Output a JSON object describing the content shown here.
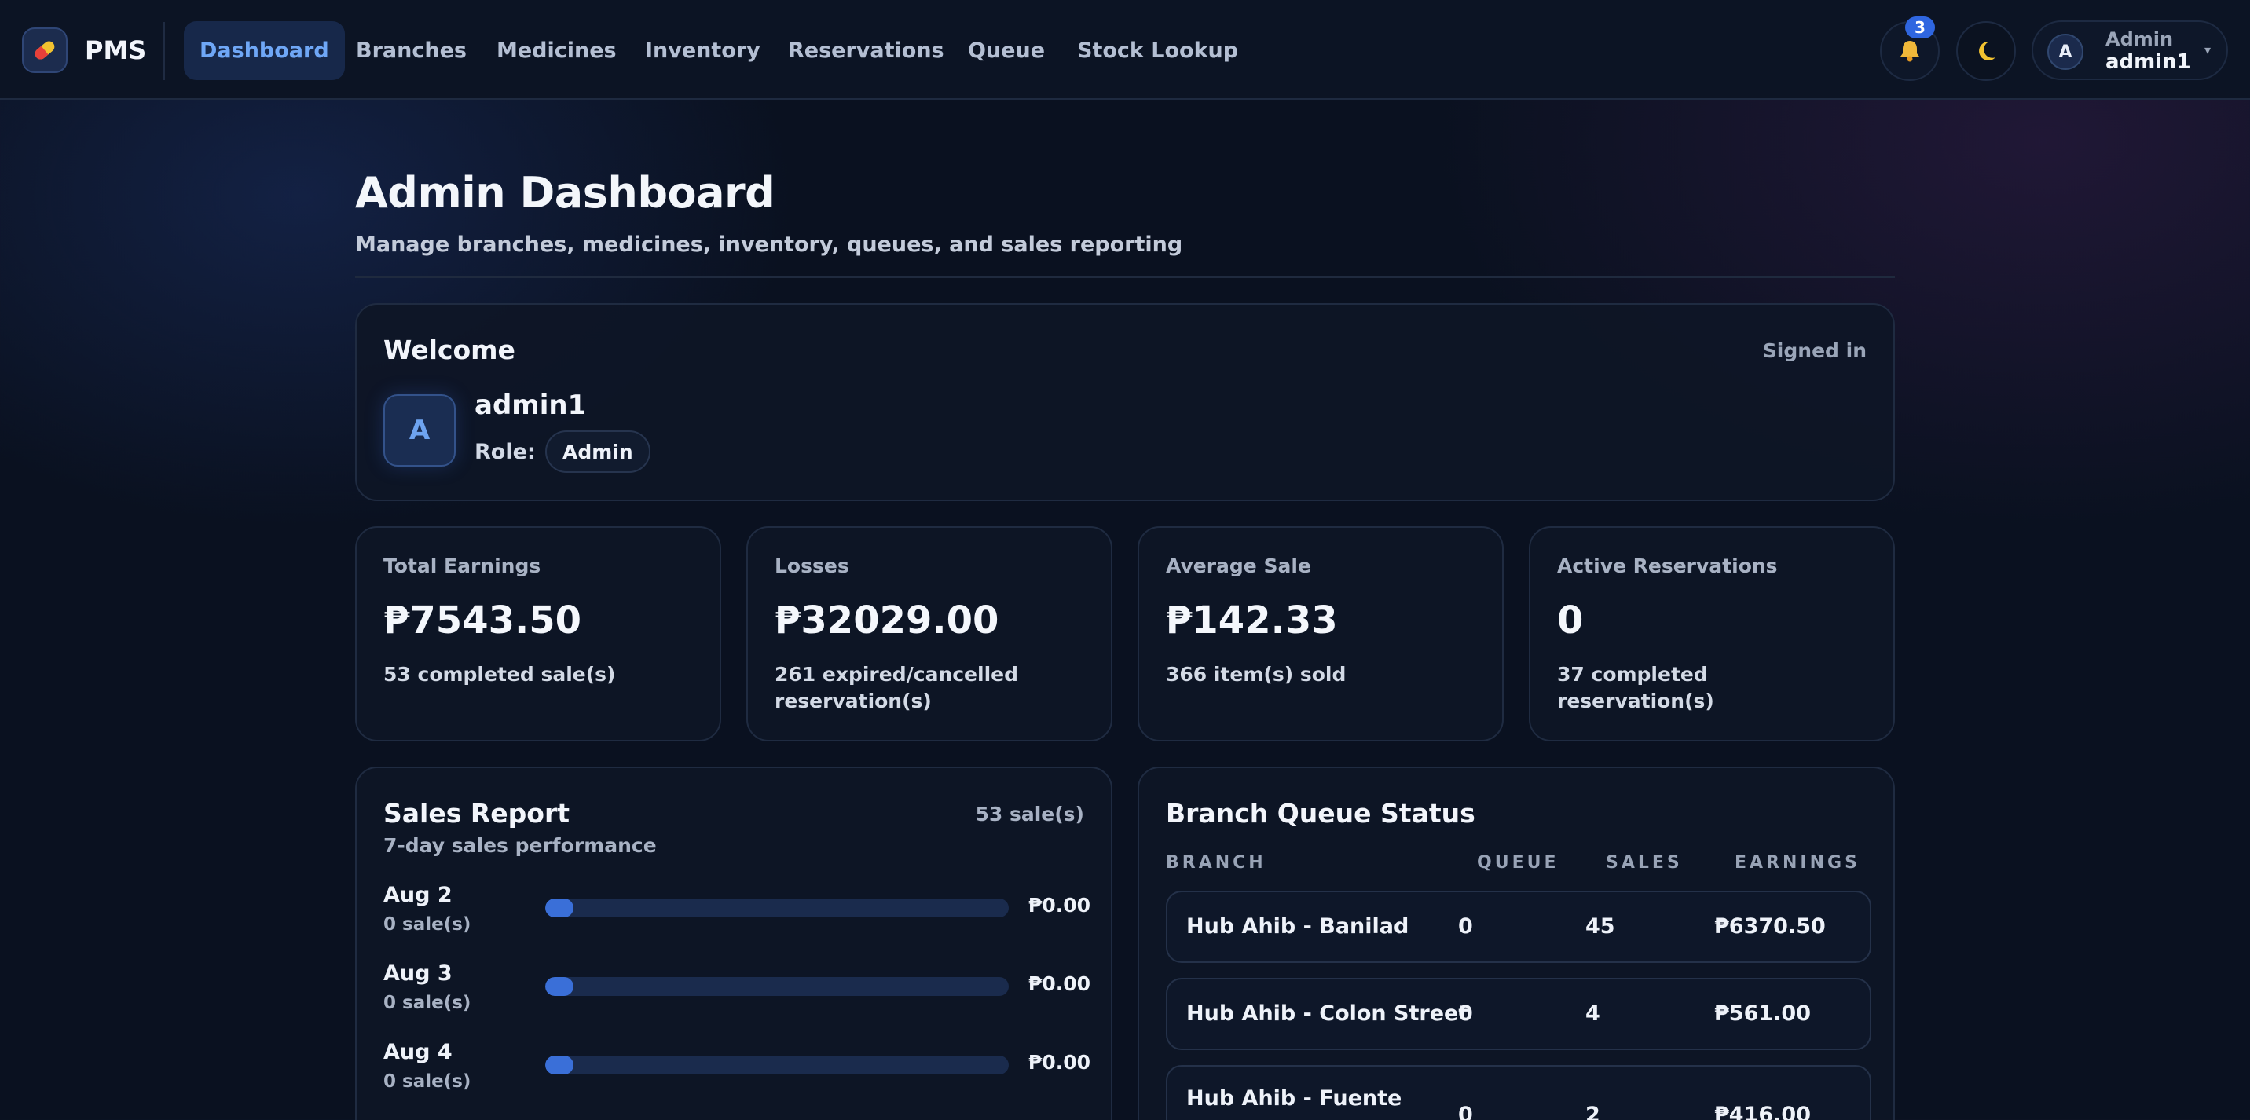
{
  "app": {
    "brand": "PMS",
    "logo_icon": "pill-icon"
  },
  "nav": {
    "items": [
      {
        "label": "Dashboard",
        "active": true
      },
      {
        "label": "Branches",
        "active": false
      },
      {
        "label": "Medicines",
        "active": false
      },
      {
        "label": "Inventory",
        "active": false
      },
      {
        "label": "Reservations",
        "active": false
      },
      {
        "label": "Queue",
        "active": false
      },
      {
        "label": "Stock Lookup",
        "active": false
      }
    ],
    "notifications": {
      "icon": "bell-icon",
      "count": "3"
    },
    "theme_toggle": {
      "icon": "moon-icon"
    },
    "user": {
      "avatar": "A",
      "role": "Admin",
      "name": "admin1",
      "caret": "▾"
    }
  },
  "header": {
    "title": "Admin Dashboard",
    "subtitle": "Manage branches, medicines, inventory, queues, and sales reporting"
  },
  "welcome": {
    "title": "Welcome",
    "status": "Signed in",
    "avatar": "A",
    "username": "admin1",
    "role_label": "Role:",
    "role": "Admin"
  },
  "stats": [
    {
      "label": "Total Earnings",
      "value": "₱7543.50",
      "note": "53 completed sale(s)"
    },
    {
      "label": "Losses",
      "value": "₱32029.00",
      "note": "261 expired/cancelled reservation(s)"
    },
    {
      "label": "Average Sale",
      "value": "₱142.33",
      "note": "366 item(s) sold"
    },
    {
      "label": "Active Reservations",
      "value": "0",
      "note": "37 completed reservation(s)"
    }
  ],
  "sales_report": {
    "title": "Sales Report",
    "subtitle": "7-day sales performance",
    "count": "53 sale(s)",
    "days": [
      {
        "day": "Aug 2",
        "sales": "0 sale(s)",
        "amount": "₱0.00",
        "fraction": 0
      },
      {
        "day": "Aug 3",
        "sales": "0 sale(s)",
        "amount": "₱0.00",
        "fraction": 0
      },
      {
        "day": "Aug 4",
        "sales": "0 sale(s)",
        "amount": "₱0.00",
        "fraction": 0
      }
    ]
  },
  "branch_queue": {
    "title": "Branch Queue Status",
    "columns": [
      "BRANCH",
      "QUEUE",
      "SALES",
      "EARNINGS"
    ],
    "rows": [
      {
        "branch": "Hub Ahib - Banilad",
        "queue": "0",
        "sales": "45",
        "earnings": "₱6370.50"
      },
      {
        "branch": "Hub Ahib - Colon Street",
        "queue": "0",
        "sales": "4",
        "earnings": "₱561.00"
      },
      {
        "branch": "Hub Ahib - Fuente",
        "queue": "0",
        "sales": "2",
        "earnings": "₱416.00"
      }
    ]
  }
}
